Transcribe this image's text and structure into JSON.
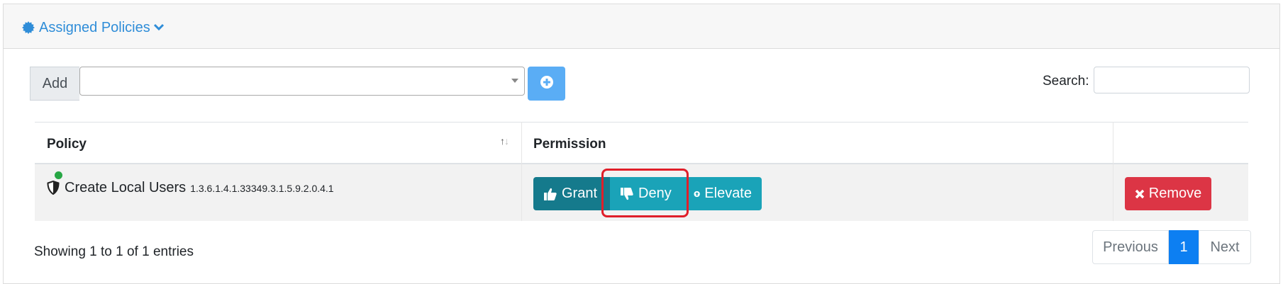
{
  "header": {
    "title": "Assigned Policies",
    "icon": "gear-badge-icon",
    "toggle_icon": "chevron-down-icon"
  },
  "toolbar": {
    "add_label": "Add",
    "select_value": "",
    "add_button_icon": "plus-circle-icon",
    "search_label": "Search:",
    "search_value": ""
  },
  "table": {
    "columns": [
      "Policy",
      "Permission",
      ""
    ],
    "rows": [
      {
        "policy_name": "Create Local Users",
        "policy_oid": "1.3.6.1.4.1.33349.3.1.5.9.2.0.4.1",
        "status": "active",
        "permission_buttons": {
          "grant": "Grant",
          "deny": "Deny",
          "elevate": "Elevate"
        },
        "remove_label": "Remove"
      }
    ]
  },
  "footer": {
    "info": "Showing 1 to 1 of 1 entries",
    "prev": "Previous",
    "current_page": "1",
    "next": "Next"
  },
  "colors": {
    "accent": "#2f8dd8",
    "grant": "#157a8c",
    "deny": "#1aa3b8",
    "remove": "#dc3545",
    "active_page": "#0d7ff2",
    "status_ok": "#28a745",
    "highlight": "#e01f2a"
  }
}
